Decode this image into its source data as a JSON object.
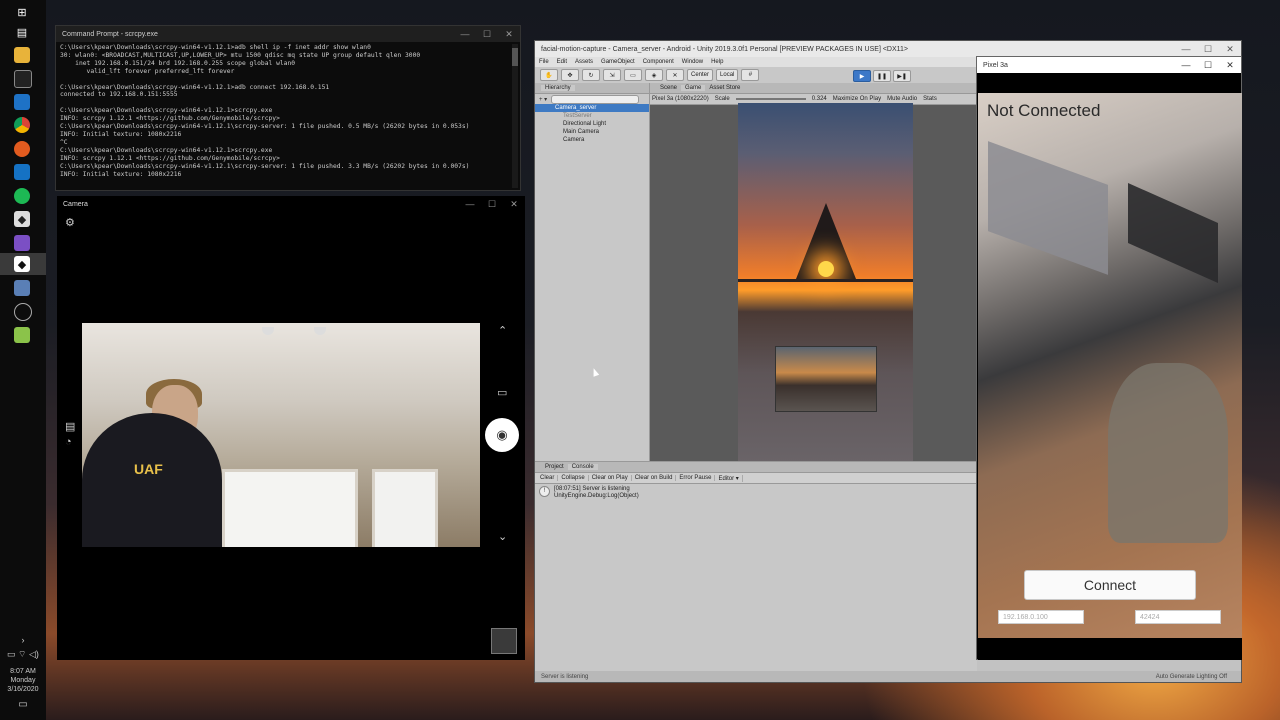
{
  "taskbar": {
    "icons": [
      "windows-start-icon",
      "task-view-icon",
      "file-explorer-icon",
      "terminal-icon",
      "vscode-icon",
      "chrome-icon",
      "firefox-icon",
      "outlook-icon",
      "spotify-icon",
      "unity-hub-icon",
      "visual-studio-icon",
      "unity-icon",
      "camera-icon",
      "clock-icon",
      "android-icon"
    ],
    "clock_time": "8:07 AM",
    "clock_day": "Monday",
    "clock_date": "3/16/2020"
  },
  "cmd": {
    "title": "Command Prompt - scrcpy.exe",
    "lines": [
      "C:\\Users\\kpear\\Downloads\\scrcpy-win64-v1.12.1>adb shell ip -f inet addr show wlan0",
      "30: wlan0: <BROADCAST,MULTICAST,UP,LOWER_UP> mtu 1500 qdisc mq state UP group default qlen 3000",
      "    inet 192.168.0.151/24 brd 192.168.0.255 scope global wlan0",
      "       valid_lft forever preferred_lft forever",
      "",
      "C:\\Users\\kpear\\Downloads\\scrcpy-win64-v1.12.1>adb connect 192.168.0.151",
      "connected to 192.168.0.151:5555",
      "",
      "C:\\Users\\kpear\\Downloads\\scrcpy-win64-v1.12.1>scrcpy.exe",
      "INFO: scrcpy 1.12.1 <https://github.com/Genymobile/scrcpy>",
      "C:\\Users\\kpear\\Downloads\\scrcpy-win64-v1.12.1\\scrcpy-server: 1 file pushed. 0.5 MB/s (26202 bytes in 0.053s)",
      "INFO: Initial texture: 1080x2216",
      "^C",
      "C:\\Users\\kpear\\Downloads\\scrcpy-win64-v1.12.1>scrcpy.exe",
      "INFO: scrcpy 1.12.1 <https://github.com/Genymobile/scrcpy>",
      "C:\\Users\\kpear\\Downloads\\scrcpy-win64-v1.12.1\\scrcpy-server: 1 file pushed. 3.3 MB/s (26202 bytes in 0.007s)",
      "INFO: Initial texture: 1080x2216"
    ]
  },
  "camera": {
    "title": "Camera",
    "shirt_logo": "UAF"
  },
  "unity": {
    "title": "facial-motion-capture - Camera_server - Android - Unity 2019.3.0f1 Personal [PREVIEW PACKAGES IN USE] <DX11>",
    "menu": [
      "File",
      "Edit",
      "Assets",
      "GameObject",
      "Component",
      "Window",
      "Help"
    ],
    "toolbar": {
      "center": "Center",
      "local": "Local"
    },
    "hierarchy_tab": "Hierarchy",
    "hierarchy_add": "+ ▾",
    "hierarchy_search_placeholder": "All",
    "hierarchy_items": [
      "Camera_server",
      "TestServer",
      "Directional Light",
      "Main Camera",
      "Camera"
    ],
    "view_tabs": [
      "Scene",
      "Game",
      "Asset Store"
    ],
    "game": {
      "display": "Pixel 3a (1080x2220)",
      "scale_label": "Scale",
      "scale_value": "0.324",
      "maximize": "Maximize On Play",
      "mute": "Mute Audio",
      "stats": "Stats"
    },
    "bottom_tabs": [
      "Project",
      "Console"
    ],
    "console_buttons": [
      "Clear",
      "Collapse",
      "Clear on Play",
      "Clear on Build",
      "Error Pause",
      "Editor ▾"
    ],
    "console_entry_line1": "[08:07:51] Server is listening",
    "console_entry_line2": "UnityEngine.Debug:Log(Object)",
    "status_left": "Server is listening",
    "status_right": "Auto Generate Lighting Off"
  },
  "pixel": {
    "title": "Pixel 3a",
    "status": "Not Connected",
    "connect_label": "Connect",
    "ip_placeholder": "192.168.0.100",
    "port_placeholder": "42424"
  }
}
